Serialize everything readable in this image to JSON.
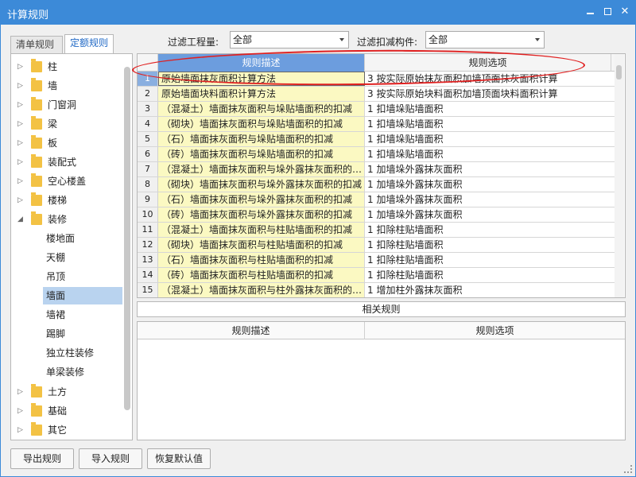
{
  "window": {
    "title": "计算规则"
  },
  "tabs": [
    {
      "label": "清单规则"
    },
    {
      "label": "定额规则"
    }
  ],
  "filters": {
    "quantity_label": "过滤工程量:",
    "quantity_value": "全部",
    "deduct_label": "过滤扣减构件:",
    "deduct_value": "全部"
  },
  "tree": {
    "nodes": [
      {
        "label": "柱",
        "expanded": false
      },
      {
        "label": "墙",
        "expanded": false
      },
      {
        "label": "门窗洞",
        "expanded": false
      },
      {
        "label": "梁",
        "expanded": false
      },
      {
        "label": "板",
        "expanded": false
      },
      {
        "label": "装配式",
        "expanded": false
      },
      {
        "label": "空心楼盖",
        "expanded": false
      },
      {
        "label": "楼梯",
        "expanded": false
      },
      {
        "label": "装修",
        "expanded": true
      }
    ],
    "children": [
      {
        "label": "楼地面"
      },
      {
        "label": "天棚"
      },
      {
        "label": "吊顶"
      },
      {
        "label": "墙面",
        "selected": true
      },
      {
        "label": "墙裙"
      },
      {
        "label": "踢脚"
      },
      {
        "label": "独立柱装修"
      },
      {
        "label": "单梁装修"
      }
    ],
    "nodes_after": [
      {
        "label": "土方"
      },
      {
        "label": "基础"
      },
      {
        "label": "其它"
      }
    ]
  },
  "grid": {
    "headers": {
      "desc": "规则描述",
      "opt": "规则选项"
    },
    "rows": [
      {
        "n": "1",
        "desc": "原始墙面抹灰面积计算方法",
        "opt": "3 按实际原始抹灰面积加墙顶面抹灰面积计算"
      },
      {
        "n": "2",
        "desc": "原始墙面块料面积计算方法",
        "opt": "3 按实际原始块料面积加墙顶面块料面积计算"
      },
      {
        "n": "3",
        "desc": "（混凝土）墙面抹灰面积与垛贴墙面积的扣减",
        "opt": "1 扣墙垛贴墙面积"
      },
      {
        "n": "4",
        "desc": "（砌块）墙面抹灰面积与垛贴墙面积的扣减",
        "opt": "1 扣墙垛贴墙面积"
      },
      {
        "n": "5",
        "desc": "（石）墙面抹灰面积与垛贴墙面积的扣减",
        "opt": "1 扣墙垛贴墙面积"
      },
      {
        "n": "6",
        "desc": "（砖）墙面抹灰面积与垛贴墙面积的扣减",
        "opt": "1 扣墙垛贴墙面积"
      },
      {
        "n": "7",
        "desc": "（混凝土）墙面抹灰面积与垛外露抹灰面积的…",
        "opt": "1 加墙垛外露抹灰面积"
      },
      {
        "n": "8",
        "desc": "（砌块）墙面抹灰面积与垛外露抹灰面积的扣减",
        "opt": "1 加墙垛外露抹灰面积"
      },
      {
        "n": "9",
        "desc": "（石）墙面抹灰面积与垛外露抹灰面积的扣减",
        "opt": "1 加墙垛外露抹灰面积"
      },
      {
        "n": "10",
        "desc": "（砖）墙面抹灰面积与垛外露抹灰面积的扣减",
        "opt": "1 加墙垛外露抹灰面积"
      },
      {
        "n": "11",
        "desc": "（混凝土）墙面抹灰面积与柱贴墙面积的扣减",
        "opt": "1 扣除柱贴墙面积"
      },
      {
        "n": "12",
        "desc": "（砌块）墙面抹灰面积与柱贴墙面积的扣减",
        "opt": "1 扣除柱贴墙面积"
      },
      {
        "n": "13",
        "desc": "（石）墙面抹灰面积与柱贴墙面积的扣减",
        "opt": "1 扣除柱贴墙面积"
      },
      {
        "n": "14",
        "desc": "（砖）墙面抹灰面积与柱贴墙面积的扣减",
        "opt": "1 扣除柱贴墙面积"
      },
      {
        "n": "15",
        "desc": "（混凝土）墙面抹灰面积与柱外露抹灰面积的…",
        "opt": "1 增加柱外露抹灰面积"
      }
    ]
  },
  "related": {
    "title": "相关规则",
    "headers": {
      "desc": "规则描述",
      "opt": "规则选项"
    }
  },
  "buttons": {
    "export": "导出规则",
    "import": "导入规则",
    "restore": "恢复默认值"
  },
  "colors": {
    "titlebar": "#3c8ad8",
    "annotation": "#e02020",
    "desc_cell": "#fbf9c2"
  }
}
